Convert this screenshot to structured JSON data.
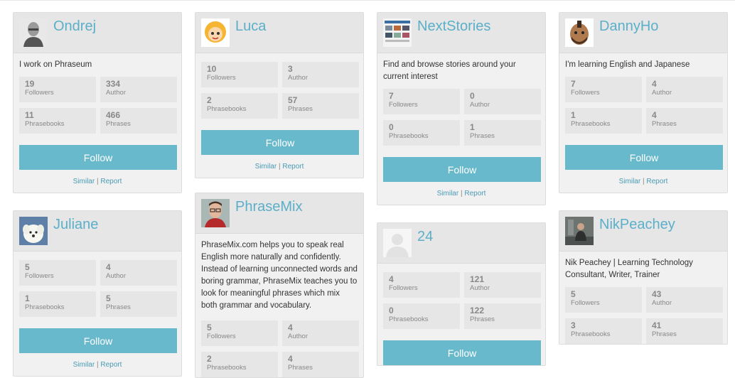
{
  "follow_label": "Follow",
  "similar_label": "Similar",
  "report_label": "Report",
  "separator": "|",
  "colors": {
    "accent": "#69b9cc",
    "name_link": "#5bafc9",
    "card_bg": "#f1f1f1",
    "card_header_bg": "#e6e6e6"
  },
  "cards": [
    {
      "name": "Ondrej",
      "avatar_icon": "man-photo-avatar",
      "description": "I work on Phraseum",
      "stats": [
        {
          "value": "19",
          "label": "Followers"
        },
        {
          "value": "334",
          "label": "Author"
        },
        {
          "value": "11",
          "label": "Phrasebooks"
        },
        {
          "value": "466",
          "label": "Phrases"
        }
      ]
    },
    {
      "name": "Luca",
      "avatar_icon": "cartoon-girl-avatar",
      "description": "",
      "stats": [
        {
          "value": "10",
          "label": "Followers"
        },
        {
          "value": "3",
          "label": "Author"
        },
        {
          "value": "2",
          "label": "Phrasebooks"
        },
        {
          "value": "57",
          "label": "Phrases"
        }
      ]
    },
    {
      "name": "NextStories",
      "avatar_icon": "website-screenshot-avatar",
      "description": "Find and browse stories around your current interest",
      "stats": [
        {
          "value": "7",
          "label": "Followers"
        },
        {
          "value": "0",
          "label": "Author"
        },
        {
          "value": "0",
          "label": "Phrasebooks"
        },
        {
          "value": "1",
          "label": "Phrases"
        }
      ]
    },
    {
      "name": "DannyHo",
      "avatar_icon": "cartoon-man-avatar",
      "description": "I'm learning English and Japanese",
      "stats": [
        {
          "value": "7",
          "label": "Followers"
        },
        {
          "value": "4",
          "label": "Author"
        },
        {
          "value": "1",
          "label": "Phrasebooks"
        },
        {
          "value": "4",
          "label": "Phrases"
        }
      ]
    },
    {
      "name": "Juliane",
      "avatar_icon": "puppy-photo-avatar",
      "description": "",
      "stats": [
        {
          "value": "5",
          "label": "Followers"
        },
        {
          "value": "4",
          "label": "Author"
        },
        {
          "value": "1",
          "label": "Phrasebooks"
        },
        {
          "value": "5",
          "label": "Phrases"
        }
      ]
    },
    {
      "name": "PhraseMix",
      "avatar_icon": "man-glasses-photo-avatar",
      "description": "PhraseMix.com helps you to speak real English more naturally and confidently. Instead of learning unconnected words and boring grammar, PhraseMix teaches you to look for meaningful phrases which mix both grammar and vocabulary.",
      "stats": [
        {
          "value": "5",
          "label": "Followers"
        },
        {
          "value": "4",
          "label": "Author"
        },
        {
          "value": "2",
          "label": "Phrasebooks"
        },
        {
          "value": "4",
          "label": "Phrases"
        }
      ]
    },
    {
      "name": "24",
      "avatar_icon": "default-user-avatar",
      "description": "",
      "stats": [
        {
          "value": "4",
          "label": "Followers"
        },
        {
          "value": "121",
          "label": "Author"
        },
        {
          "value": "0",
          "label": "Phrasebooks"
        },
        {
          "value": "122",
          "label": "Phrases"
        }
      ]
    },
    {
      "name": "NikPeachey",
      "avatar_icon": "man-seated-photo-avatar",
      "description": "Nik Peachey | Learning Technology Consultant, Writer, Trainer",
      "stats": [
        {
          "value": "5",
          "label": "Followers"
        },
        {
          "value": "43",
          "label": "Author"
        },
        {
          "value": "3",
          "label": "Phrasebooks"
        },
        {
          "value": "41",
          "label": "Phrases"
        }
      ]
    }
  ]
}
